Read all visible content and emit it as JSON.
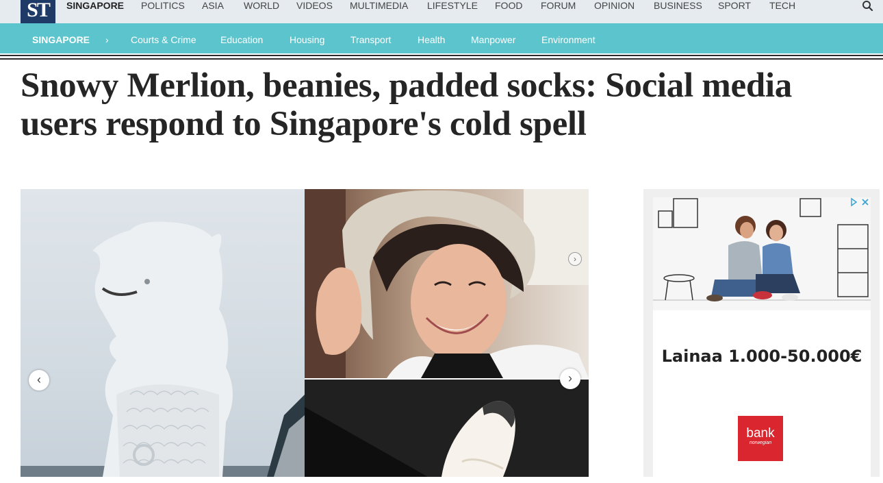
{
  "top_nav": {
    "logo": "ST",
    "items": [
      "SINGAPORE",
      "POLITICS",
      "ASIA",
      "WORLD",
      "VIDEOS",
      "MULTIMEDIA",
      "LIFESTYLE",
      "FOOD",
      "FORUM",
      "OPINION",
      "BUSINESS",
      "SPORT",
      "TECH"
    ],
    "active": "SINGAPORE",
    "search_icon": "search-icon"
  },
  "section_nav": {
    "home": "SINGAPORE",
    "separator": "›",
    "items": [
      "Courts & Crime",
      "Education",
      "Housing",
      "Transport",
      "Health",
      "Manpower",
      "Environment"
    ]
  },
  "article": {
    "headline": "Snowy Merlion, beanies, padded socks: Social media users respond to Singapore's cold spell"
  },
  "gallery": {
    "prev_icon": "‹",
    "next_icon": "›"
  },
  "ad": {
    "headline": "Lainaa 1.000-50.000€",
    "logo_text": "bank",
    "logo_subtext": "norwegian",
    "choices_icon": "adchoices-icon"
  },
  "colors": {
    "top_nav_bg": "#e6ebf0",
    "section_bar": "#5cc4cc",
    "logo_bg": "#1f3a66",
    "ad_logo": "#d9262f"
  }
}
